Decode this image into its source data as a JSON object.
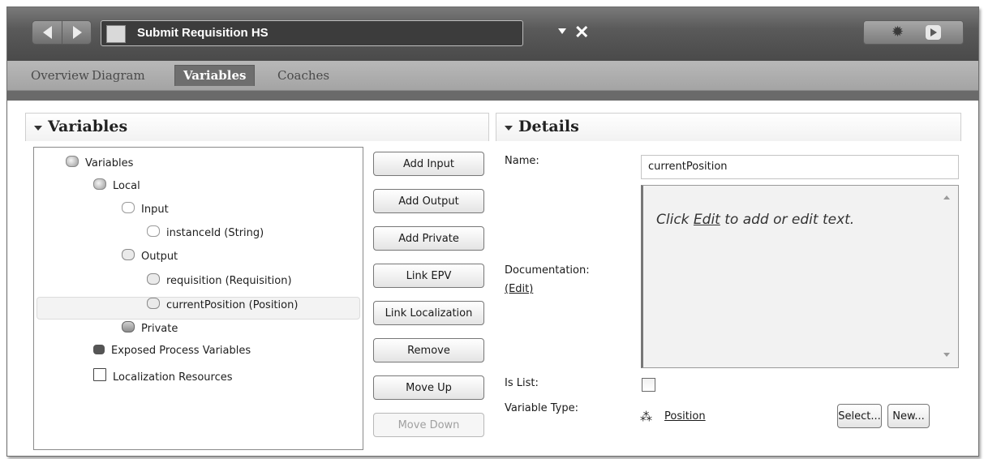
{
  "editor": {
    "title": "Submit Requisition HS",
    "close_glyph": "✕"
  },
  "tabs": [
    {
      "label": "Overview",
      "active": false
    },
    {
      "label": "Diagram",
      "active": false
    },
    {
      "label": "Variables",
      "active": true
    },
    {
      "label": "Coaches",
      "active": false
    }
  ],
  "variables_panel": {
    "title": "Variables",
    "tree": [
      {
        "label": "Variables",
        "icon": "group-icon",
        "depth": 0
      },
      {
        "label": "Local",
        "icon": "group-icon",
        "depth": 1
      },
      {
        "label": "Input",
        "icon": "input-icon",
        "depth": 2
      },
      {
        "label": "instanceId (String)",
        "icon": "input-icon",
        "depth": 3
      },
      {
        "label": "Output",
        "icon": "output-icon",
        "depth": 2
      },
      {
        "label": "requisition (Requisition)",
        "icon": "output-icon",
        "depth": 3
      },
      {
        "label": "currentPosition (Position)",
        "icon": "output-icon",
        "depth": 3,
        "selected": true
      },
      {
        "label": "Private",
        "icon": "private-icon",
        "depth": 2
      },
      {
        "label": "Exposed Process Variables",
        "icon": "people-icon",
        "depth": 1
      },
      {
        "label": "Localization Resources",
        "icon": "document-icon",
        "depth": 1
      }
    ],
    "buttons": {
      "add_input": "Add Input",
      "add_output": "Add Output",
      "add_private": "Add Private",
      "link_epv": "Link EPV",
      "link_localization": "Link Localization",
      "remove": "Remove",
      "move_up": "Move Up",
      "move_down": "Move Down"
    }
  },
  "details_panel": {
    "title": "Details",
    "name_label": "Name:",
    "name_value": "currentPosition",
    "documentation_label": "Documentation:",
    "documentation_edit_link": "(Edit)",
    "documentation_hint_pre": "Click ",
    "documentation_hint_link": "Edit",
    "documentation_hint_post": " to add or edit text.",
    "is_list_label": "Is List:",
    "is_list_checked": false,
    "variable_type_label": "Variable Type:",
    "variable_type_value": "Position",
    "select_button": "Select...",
    "new_button": "New..."
  },
  "colors": {
    "titlebar": "#5a5a5a",
    "tabbar": "#ababab",
    "active_tab": "#6e6e6e"
  }
}
